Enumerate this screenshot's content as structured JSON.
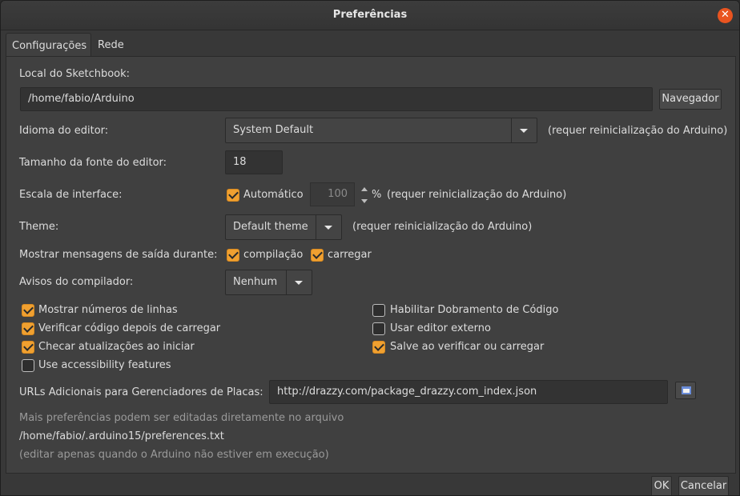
{
  "window": {
    "title": "Preferências"
  },
  "tabs": [
    {
      "label": "Configurações"
    },
    {
      "label": "Rede"
    }
  ],
  "settings": {
    "sketchbook_label": "Local do Sketchbook:",
    "sketchbook_path": "/home/fabio/Arduino",
    "browse_label": "Navegador",
    "language_label": "Idioma do editor:",
    "language_value": "System Default",
    "restart_note": "(requer reinicialização do Arduino)",
    "font_size_label": "Tamanho da fonte do editor:",
    "font_size_value": "18",
    "scale_label": "Escala de interface:",
    "scale_auto_label": "Automático",
    "scale_value": "100",
    "percent_sign": "%",
    "theme_label": "Theme:",
    "theme_value": "Default theme",
    "verbose_label": "Mostrar mensagens de saída durante:",
    "verbose_compile_label": "compilação",
    "verbose_upload_label": "carregar",
    "warnings_label": "Avisos do compilador:",
    "warnings_value": "Nenhum"
  },
  "checkboxes": [
    {
      "label": "Mostrar números de linhas",
      "checked": true
    },
    {
      "label": "Verificar código depois de carregar",
      "checked": true
    },
    {
      "label": "Checar atualizações ao iniciar",
      "checked": true
    },
    {
      "label": "Use accessibility features",
      "checked": false
    },
    {
      "label": "Habilitar Dobramento de Código",
      "checked": false
    },
    {
      "label": "Usar editor externo",
      "checked": false
    },
    {
      "label": "Salve ao verificar ou carregar",
      "checked": true
    }
  ],
  "boards": {
    "label": "URLs Adicionais para Gerenciadores de Placas:",
    "value": "http://drazzy.com/package_drazzy.com_index.json"
  },
  "footer": {
    "info_line": "Mais preferências podem ser editadas diretamente no arquivo",
    "prefs_path": "/home/fabio/.arduino15/preferences.txt",
    "edit_note": "(editar apenas quando o Arduino não estiver em execução)"
  },
  "buttons": {
    "ok": "OK",
    "cancel": "Cancelar"
  },
  "colors": {
    "accent": "#f0a030",
    "close": "#e95420",
    "panel": "#404040"
  },
  "icons": {
    "close": "close-icon",
    "dropdown": "chevron-down-icon",
    "url_editor": "window-icon"
  }
}
